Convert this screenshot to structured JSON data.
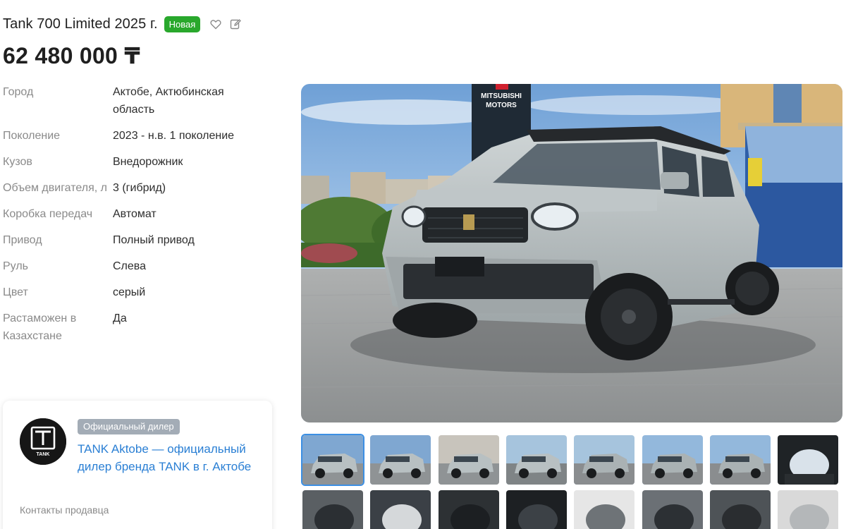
{
  "listing": {
    "title": "Tank 700 Limited 2025 г.",
    "badge": "Новая",
    "price": "62 480 000 ₸"
  },
  "icons": [
    "heart-icon",
    "edit-note-icon"
  ],
  "specs": [
    {
      "label": "Город",
      "value": "Актобе, Актюбинская область"
    },
    {
      "label": "Поколение",
      "value": "2023 - н.в. 1 поколение"
    },
    {
      "label": "Кузов",
      "value": "Внедорожник"
    },
    {
      "label": "Объем двигателя, л",
      "value": "3 (гибрид)"
    },
    {
      "label": "Коробка передач",
      "value": "Автомат"
    },
    {
      "label": "Привод",
      "value": "Полный привод"
    },
    {
      "label": "Руль",
      "value": "Слева"
    },
    {
      "label": "Цвет",
      "value": "серый"
    },
    {
      "label": "Растаможен в Казахстане",
      "value": "Да"
    }
  ],
  "dealer": {
    "badge": "Официальный дилер",
    "name": "TANK Aktobe — официальный дилер бренда TANK в г. Актобе",
    "logo_text": "TANK",
    "contacts_label": "Контакты продавца"
  },
  "photo": {
    "billboard_line1": "MITSUBISHI",
    "billboard_line2": "MOTORS",
    "thumbnail_count": 16,
    "active_thumbnail": 1
  },
  "colors": {
    "badge_green": "#29a82c",
    "link_blue": "#2a7fd4",
    "active_thumb_border": "#3c8fe3",
    "muted_label": "#8a8a8a"
  }
}
